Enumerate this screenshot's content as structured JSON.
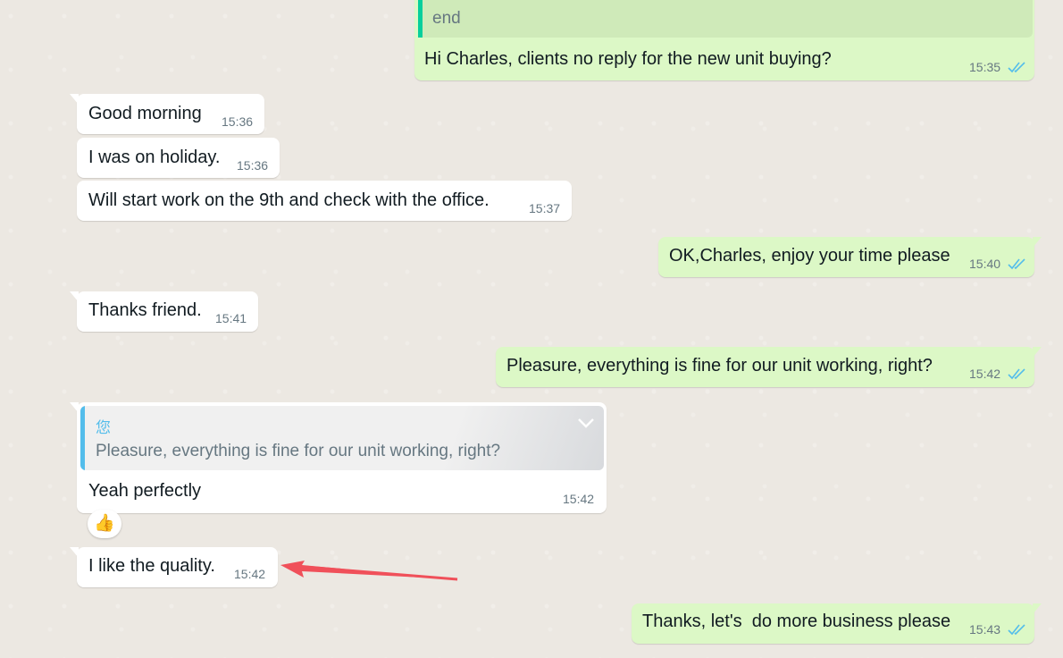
{
  "chat": {
    "top_reply": {
      "quoted_text": "end",
      "text": "Hi Charles, clients no reply for the new unit buying?",
      "time": "15:35"
    },
    "messages": [
      {
        "text": "Good morning",
        "time": "15:36"
      },
      {
        "text": "I was on holiday.",
        "time": "15:36"
      },
      {
        "text": "Will start work on the 9th and check with the office.",
        "time": "15:37"
      },
      {
        "text": "OK,Charles, enjoy your time please",
        "time": "15:40"
      },
      {
        "text": "Thanks friend.",
        "time": "15:41"
      },
      {
        "text": "Pleasure, everything is fine for our unit working, right?",
        "time": "15:42"
      },
      {
        "text": "Yeah perfectly",
        "time": "15:42"
      },
      {
        "text": "I like the quality.",
        "time": "15:42"
      },
      {
        "text": "Thanks, let's  do more business please",
        "time": "15:43"
      }
    ],
    "reply_quote": {
      "author": "您",
      "text": "Pleasure, everything is fine for our unit working, right?"
    },
    "reaction": "👍"
  },
  "colors": {
    "incoming_bubble": "#ffffff",
    "outgoing_bubble": "#dcf8c6",
    "chat_background": "#ece8e2",
    "read_ticks": "#53bdeb",
    "annotation_arrow": "#f0505a"
  },
  "icons": [
    "double-check-icon",
    "chevron-down-icon",
    "thumbs-up-emoji",
    "annotation-arrow"
  ]
}
